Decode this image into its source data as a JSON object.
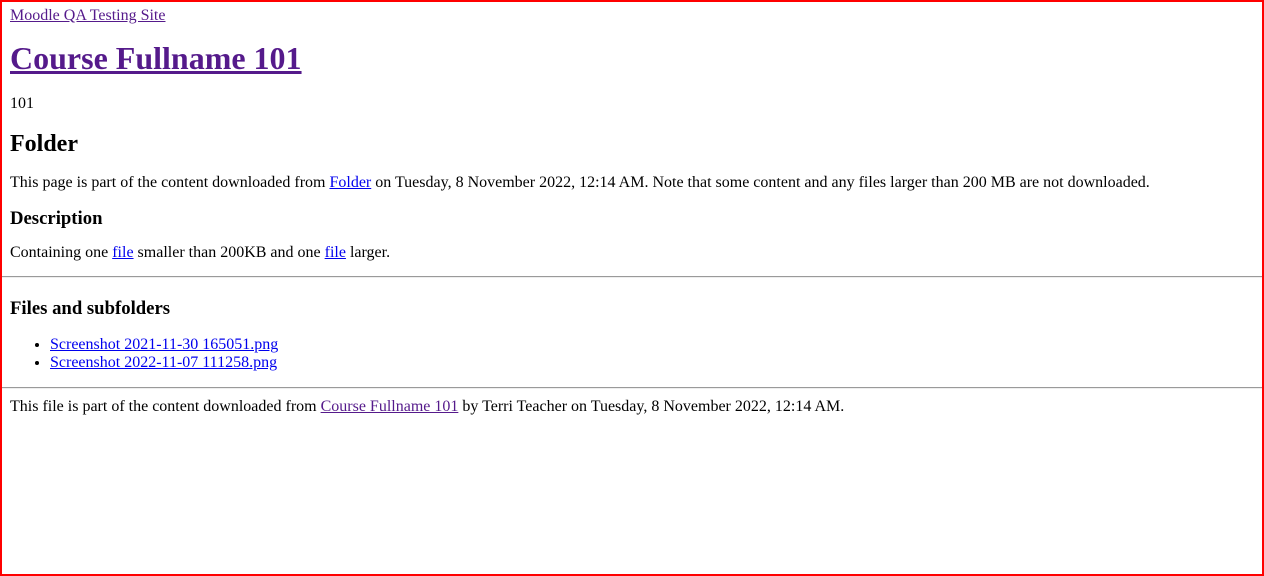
{
  "site": {
    "link_label": "Moodle QA Testing Site"
  },
  "course": {
    "fullname": "Course Fullname 101",
    "shortname": "101"
  },
  "activity": {
    "type_heading": "Folder"
  },
  "notice": {
    "prefix": "This page is part of the content downloaded from ",
    "link_label": "Folder",
    "suffix": " on Tuesday, 8 November 2022, 12:14 AM. Note that some content and any files larger than 200 MB are not downloaded."
  },
  "description": {
    "heading": "Description",
    "part1": "Containing one ",
    "link1": "file",
    "part2": " smaller than 200KB and one ",
    "link2": "file",
    "part3": " larger."
  },
  "files": {
    "heading": "Files and subfolders",
    "items": [
      {
        "name": "Screenshot 2021-11-30 165051.png"
      },
      {
        "name": "Screenshot 2022-11-07 111258.png"
      }
    ]
  },
  "footer": {
    "prefix": "This file is part of the content downloaded from ",
    "link_label": "Course Fullname 101",
    "suffix": " by Terri Teacher on Tuesday, 8 November 2022, 12:14 AM."
  },
  "colors": {
    "link": "#0000ee",
    "visited_link": "#551a8b",
    "frame_border": "#ff0000"
  }
}
